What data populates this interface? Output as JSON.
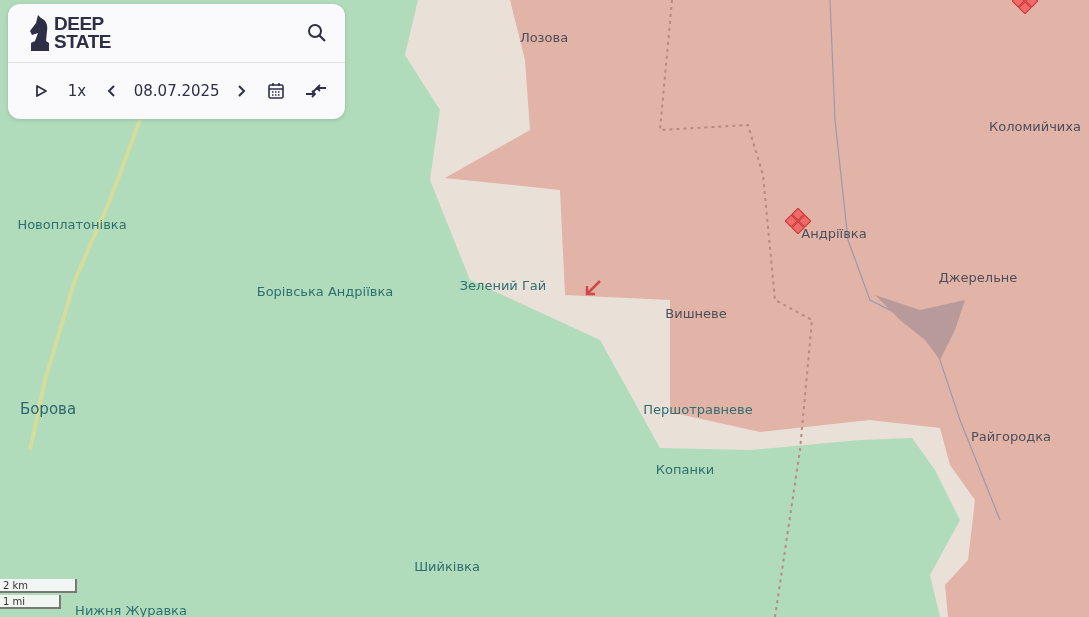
{
  "panel": {
    "logo": {
      "line1": "DEEP",
      "line2": "STATE"
    },
    "speed": "1x",
    "date": "08.07.2025"
  },
  "places": [
    {
      "name": "Лозова",
      "kind": "occupied"
    },
    {
      "name": "Коломийчиха",
      "kind": "occupied"
    },
    {
      "name": "Новоплатонівка",
      "kind": "free"
    },
    {
      "name": "Андріївка",
      "kind": "occupied"
    },
    {
      "name": "Джерельне",
      "kind": "occupied"
    },
    {
      "name": "Борівська Андріївка",
      "kind": "free"
    },
    {
      "name": "Зелений Гай",
      "kind": "free"
    },
    {
      "name": "Вишневе",
      "kind": "occupied"
    },
    {
      "name": "Борова",
      "kind": "town"
    },
    {
      "name": "Першотравневе",
      "kind": "free"
    },
    {
      "name": "Райгородка",
      "kind": "occupied"
    },
    {
      "name": "Копанки",
      "kind": "free"
    },
    {
      "name": "Шийківка",
      "kind": "free"
    },
    {
      "name": "Нижня Журавка",
      "kind": "free"
    }
  ],
  "scale": {
    "metric": "2 km",
    "imperial": "1 mi"
  }
}
